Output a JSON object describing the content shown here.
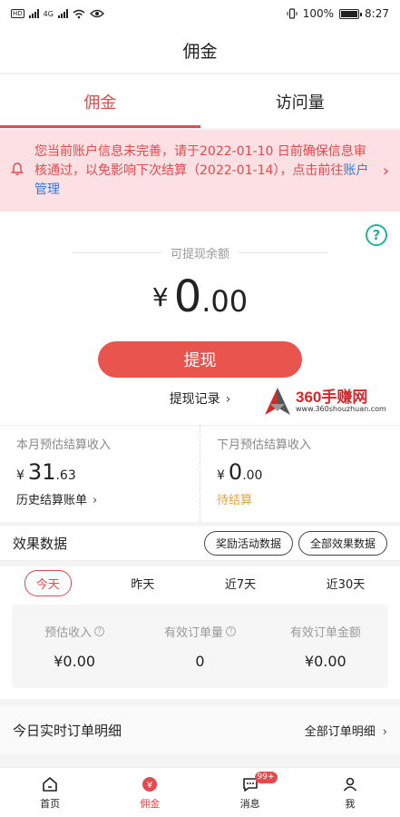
{
  "status_bar": {
    "battery": "100%",
    "time": "8:27",
    "sim_label": "HD",
    "network": "4G"
  },
  "header": {
    "title": "佣金"
  },
  "tabs": [
    {
      "label": "佣金",
      "active": true
    },
    {
      "label": "访问量",
      "active": false
    }
  ],
  "notice": {
    "text": "您当前账户信息未完善，请于2022-01-10 日前确保信息审核通过，以免影响下次结算（2022-01-14），点击前往",
    "link": "账户管理"
  },
  "balance": {
    "label": "可提现余额",
    "currency": "¥",
    "amount_int": "0",
    "amount_dec": ".00",
    "withdraw_label": "提现",
    "records_label": "提现记录"
  },
  "watermark": {
    "title": "360手赚网",
    "url": "www.360shouzhuan.com"
  },
  "income": {
    "this_month": {
      "label": "本月预估结算收入",
      "currency": "¥",
      "int": "31",
      "dec": ".63",
      "link": "历史结算账单"
    },
    "next_month": {
      "label": "下月预估结算收入",
      "currency": "¥",
      "int": "0",
      "dec": ".00",
      "status": "待结算"
    }
  },
  "effect": {
    "title": "效果数据",
    "buttons": [
      "奖励活动数据",
      "全部效果数据"
    ],
    "date_tabs": [
      {
        "label": "今天",
        "active": true
      },
      {
        "label": "昨天",
        "active": false
      },
      {
        "label": "近7天",
        "active": false
      },
      {
        "label": "近30天",
        "active": false
      }
    ],
    "stats": [
      {
        "label": "预估收入",
        "value": "¥0.00",
        "help": true
      },
      {
        "label": "有效订单量",
        "value": "0",
        "help": true
      },
      {
        "label": "有效订单金额",
        "value": "¥0.00",
        "help": false
      }
    ]
  },
  "orders": {
    "title": "今日实时订单明细",
    "link": "全部订单明细"
  },
  "bottom_nav": [
    {
      "label": "首页",
      "icon": "home-icon",
      "active": false
    },
    {
      "label": "佣金",
      "icon": "commission-icon",
      "active": true
    },
    {
      "label": "消息",
      "icon": "message-icon",
      "active": false,
      "badge": "99+"
    },
    {
      "label": "我",
      "icon": "profile-icon",
      "active": false
    }
  ],
  "colors": {
    "accent": "#e5484d",
    "link": "#2f7be5",
    "pending": "#e6a23c",
    "help": "#1fb59a"
  }
}
